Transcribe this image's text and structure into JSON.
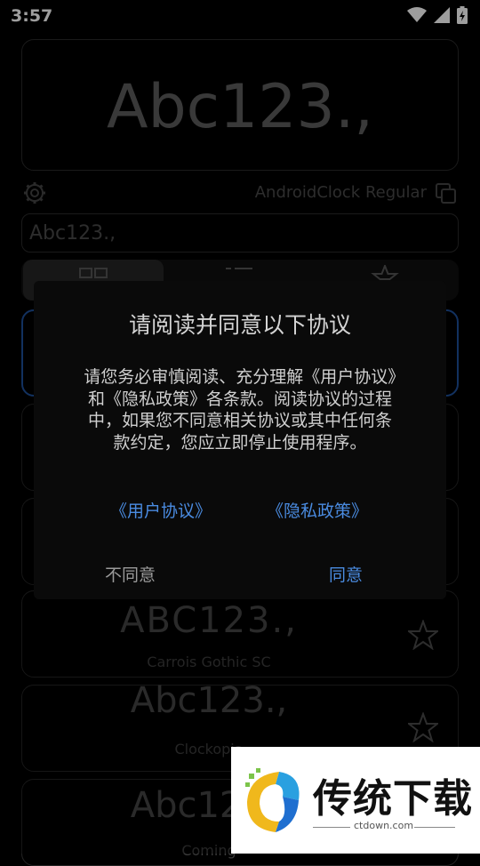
{
  "status_bar": {
    "time": "3:57"
  },
  "preview": {
    "sample_text": "Abc123.,"
  },
  "font_info": {
    "name": "AndroidClock Regular"
  },
  "input": {
    "value": "Abc123.,"
  },
  "font_list": [
    {
      "sample": "ABC123.,",
      "name": "Carrois Gothic SC"
    },
    {
      "sample": "Abc123.,",
      "name": "Clockopia"
    },
    {
      "sample": "Abc123.,",
      "name": "Coming"
    }
  ],
  "dialog": {
    "title": "请阅读并同意以下协议",
    "body": "请您务必审慎阅读、充分理解《用户协议》和《隐私政策》各条款。阅读协议的过程中，如果您不同意相关协议或其中任何条款约定，您应立即停止使用程序。",
    "link_user": "《用户协议》",
    "link_privacy": "《隐私政策》",
    "disagree": "不同意",
    "agree": "同意"
  },
  "watermark": {
    "title": "传统下载",
    "url": "ctdown.com"
  },
  "colors": {
    "accent": "#4a8be0",
    "selected_border": "#1e4f9a"
  }
}
